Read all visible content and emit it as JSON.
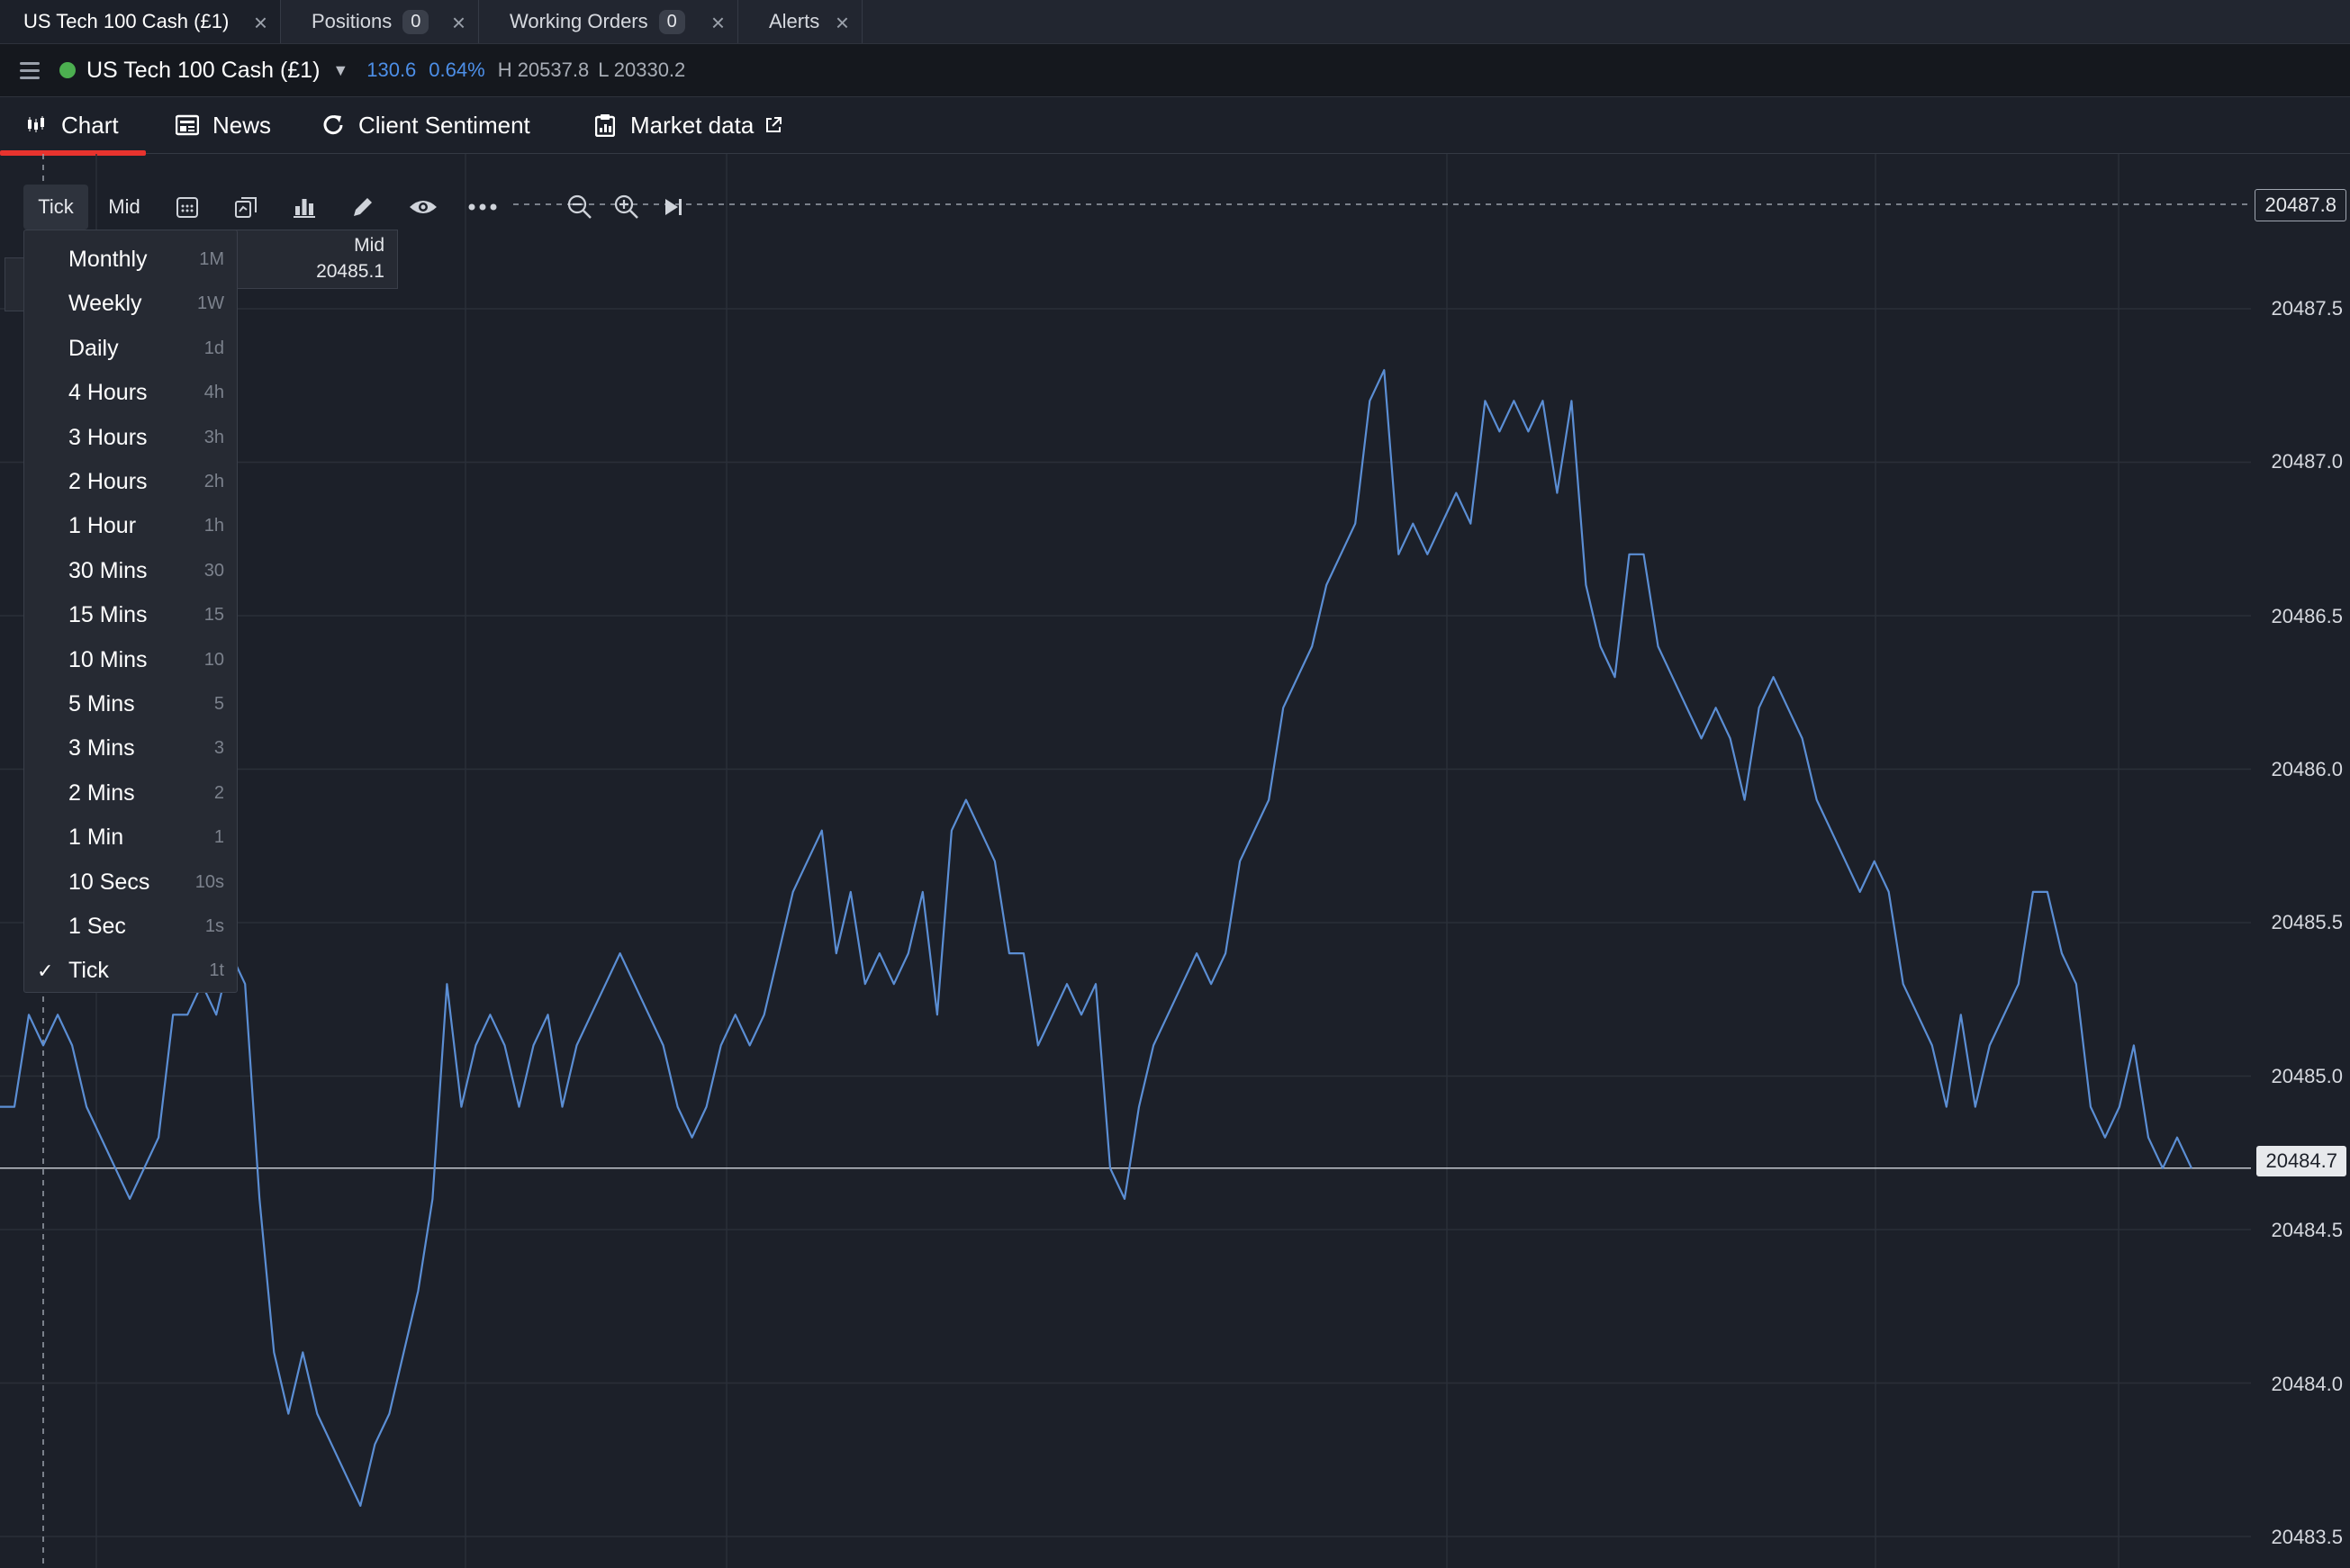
{
  "tabs": [
    {
      "label": "US Tech 100 Cash (£1)",
      "count": null
    },
    {
      "label": "Positions",
      "count": "0"
    },
    {
      "label": "Working Orders",
      "count": "0"
    },
    {
      "label": "Alerts",
      "count": null
    }
  ],
  "market": {
    "title": "US Tech 100 Cash (£1)",
    "change": "130.6",
    "change_pct": "0.64%",
    "high": "H 20537.8",
    "low": "L 20330.2",
    "status_color": "#4caf50"
  },
  "nav": {
    "chart": "Chart",
    "news": "News",
    "sentiment": "Client Sentiment",
    "market_data": "Market data"
  },
  "toolbar": {
    "interval": "Tick",
    "price_type": "Mid"
  },
  "tooltip": {
    "label": "Mid",
    "value": "20485.1"
  },
  "dropdown": {
    "items": [
      {
        "label": "Monthly",
        "shortcut": "1M"
      },
      {
        "label": "Weekly",
        "shortcut": "1W"
      },
      {
        "label": "Daily",
        "shortcut": "1d"
      },
      {
        "label": "4 Hours",
        "shortcut": "4h"
      },
      {
        "label": "3 Hours",
        "shortcut": "3h"
      },
      {
        "label": "2 Hours",
        "shortcut": "2h"
      },
      {
        "label": "1 Hour",
        "shortcut": "1h"
      },
      {
        "label": "30 Mins",
        "shortcut": "30"
      },
      {
        "label": "15 Mins",
        "shortcut": "15"
      },
      {
        "label": "10 Mins",
        "shortcut": "10"
      },
      {
        "label": "5 Mins",
        "shortcut": "5"
      },
      {
        "label": "3 Mins",
        "shortcut": "3"
      },
      {
        "label": "2 Mins",
        "shortcut": "2"
      },
      {
        "label": "1 Min",
        "shortcut": "1"
      },
      {
        "label": "10 Secs",
        "shortcut": "10s"
      },
      {
        "label": "1 Sec",
        "shortcut": "1s"
      },
      {
        "label": "Tick",
        "shortcut": "1t",
        "checked": true
      }
    ]
  },
  "axis": {
    "labels": [
      "20487.5",
      "20487.0",
      "20486.5",
      "20486.0",
      "20485.5",
      "20485.0",
      "20484.5",
      "20484.0",
      "20483.5"
    ],
    "top_price": "20487.8",
    "current_price": "20484.7"
  },
  "chart_data": {
    "type": "line",
    "ylim": [
      20483.5,
      20487.8
    ],
    "yticks": [
      20483.5,
      20484.0,
      20484.5,
      20485.0,
      20485.5,
      20486.0,
      20486.5,
      20487.0,
      20487.5
    ],
    "series": [
      {
        "values": [
          20484.9,
          20484.9,
          20485.2,
          20485.1,
          20485.2,
          20485.1,
          20484.9,
          20484.8,
          20484.7,
          20484.6,
          20484.7,
          20484.8,
          20485.2,
          20485.2,
          20485.3,
          20485.2,
          20485.4,
          20485.3,
          20484.6,
          20484.1,
          20483.9,
          20484.1,
          20483.9,
          20483.8,
          20483.7,
          20483.6,
          20483.8,
          20483.9,
          20484.1,
          20484.3,
          20484.6,
          20485.3,
          20484.9,
          20485.1,
          20485.2,
          20485.1,
          20484.9,
          20485.1,
          20485.2,
          20484.9,
          20485.1,
          20485.2,
          20485.3,
          20485.4,
          20485.3,
          20485.2,
          20485.1,
          20484.9,
          20484.8,
          20484.9,
          20485.1,
          20485.2,
          20485.1,
          20485.2,
          20485.4,
          20485.6,
          20485.7,
          20485.8,
          20485.4,
          20485.6,
          20485.3,
          20485.4,
          20485.3,
          20485.4,
          20485.6,
          20485.2,
          20485.8,
          20485.9,
          20485.8,
          20485.7,
          20485.4,
          20485.4,
          20485.1,
          20485.2,
          20485.3,
          20485.2,
          20485.3,
          20484.7,
          20484.6,
          20484.9,
          20485.1,
          20485.2,
          20485.3,
          20485.4,
          20485.3,
          20485.4,
          20485.7,
          20485.8,
          20485.9,
          20486.2,
          20486.3,
          20486.4,
          20486.6,
          20486.7,
          20486.8,
          20487.2,
          20487.3,
          20486.7,
          20486.8,
          20486.7,
          20486.8,
          20486.9,
          20486.8,
          20487.2,
          20487.1,
          20487.2,
          20487.1,
          20487.2,
          20486.9,
          20487.2,
          20486.6,
          20486.4,
          20486.3,
          20486.7,
          20486.7,
          20486.4,
          20486.3,
          20486.2,
          20486.1,
          20486.2,
          20486.1,
          20485.9,
          20486.2,
          20486.3,
          20486.2,
          20486.1,
          20485.9,
          20485.8,
          20485.7,
          20485.6,
          20485.7,
          20485.6,
          20485.3,
          20485.2,
          20485.1,
          20484.9,
          20485.2,
          20484.9,
          20485.1,
          20485.2,
          20485.3,
          20485.6,
          20485.6,
          20485.4,
          20485.3,
          20484.9,
          20484.8,
          20484.9,
          20485.1,
          20484.8,
          20484.7,
          20484.8,
          20484.7
        ]
      }
    ]
  },
  "colors": {
    "background": "#1c2029",
    "line": "#5b8ed4",
    "accent_red": "#e8332e",
    "change_blue": "#4d8fe8"
  }
}
